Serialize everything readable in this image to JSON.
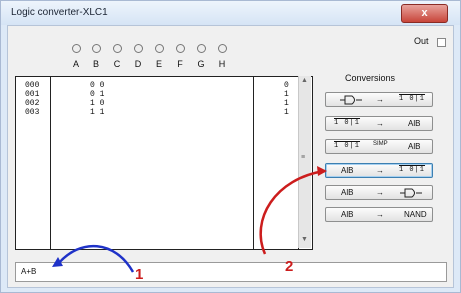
{
  "window": {
    "title": "Logic converter-XLC1",
    "close_glyph": "x"
  },
  "output": {
    "label": "Out"
  },
  "variables": [
    "A",
    "B",
    "C",
    "D",
    "E",
    "F",
    "G",
    "H"
  ],
  "table": {
    "rows": [
      {
        "index": "000",
        "bits": "0 0",
        "out": "0"
      },
      {
        "index": "001",
        "bits": "0 1",
        "out": "1"
      },
      {
        "index": "002",
        "bits": "1 0",
        "out": "1"
      },
      {
        "index": "003",
        "bits": "1 1",
        "out": "1"
      }
    ]
  },
  "conversions": {
    "title": "Conversions",
    "buttons": [
      {
        "left": "circuit-icon",
        "arrow": "→",
        "right": "1 0|1"
      },
      {
        "left": "1 0|1",
        "arrow": "→",
        "right": "AlB"
      },
      {
        "left": "1 0|1",
        "arrow": "SIMP",
        "right": "AlB"
      },
      {
        "left": "AlB",
        "arrow": "→",
        "right": "1 0|1"
      },
      {
        "left": "AlB",
        "arrow": "→",
        "right": "circuit-icon"
      },
      {
        "left": "AlB",
        "arrow": "→",
        "right": "NAND"
      }
    ]
  },
  "expression": {
    "value": "A+B"
  },
  "annotations": {
    "one": "1",
    "two": "2"
  },
  "colors": {
    "annotation_red": "#cc1d1d",
    "annotation_blue": "#1f32c8",
    "focus_border": "#3c7fb1"
  }
}
